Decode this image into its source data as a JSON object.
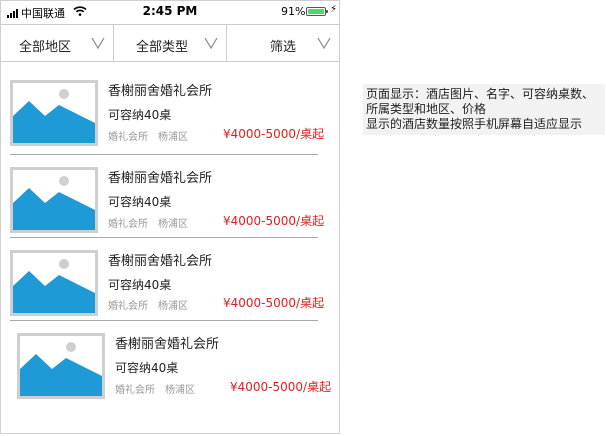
{
  "status_bar": {
    "carrier": "中国联通",
    "time": "2:45 PM",
    "battery": "91%"
  },
  "filters": [
    {
      "label": "全部地区"
    },
    {
      "label": "全部类型"
    },
    {
      "label": "筛选"
    }
  ],
  "hotels": [
    {
      "name": "香榭丽舍婚礼会所",
      "capacity": "可容纳40桌",
      "type": "婚礼会所",
      "district": "杨浦区",
      "price": "¥4000-5000/桌起"
    },
    {
      "name": "香榭丽舍婚礼会所",
      "capacity": "可容纳40桌",
      "type": "婚礼会所",
      "district": "杨浦区",
      "price": "¥4000-5000/桌起"
    },
    {
      "name": "香榭丽舍婚礼会所",
      "capacity": "可容纳40桌",
      "type": "婚礼会所",
      "district": "杨浦区",
      "price": "¥4000-5000/桌起"
    },
    {
      "name": "香榭丽舍婚礼会所",
      "capacity": "可容纳40桌",
      "type": "婚礼会所",
      "district": "杨浦区",
      "price": "¥4000-5000/桌起"
    }
  ],
  "annotation": {
    "line1": "页面显示：酒店图片、名字、可容纳桌数、所属类型和地区、价格",
    "line2": "显示的酒店数量按照手机屏幕自适应显示"
  },
  "colors": {
    "price": "#e02020",
    "image_blue": "#1e9bd7",
    "battery": "#4cd964"
  }
}
